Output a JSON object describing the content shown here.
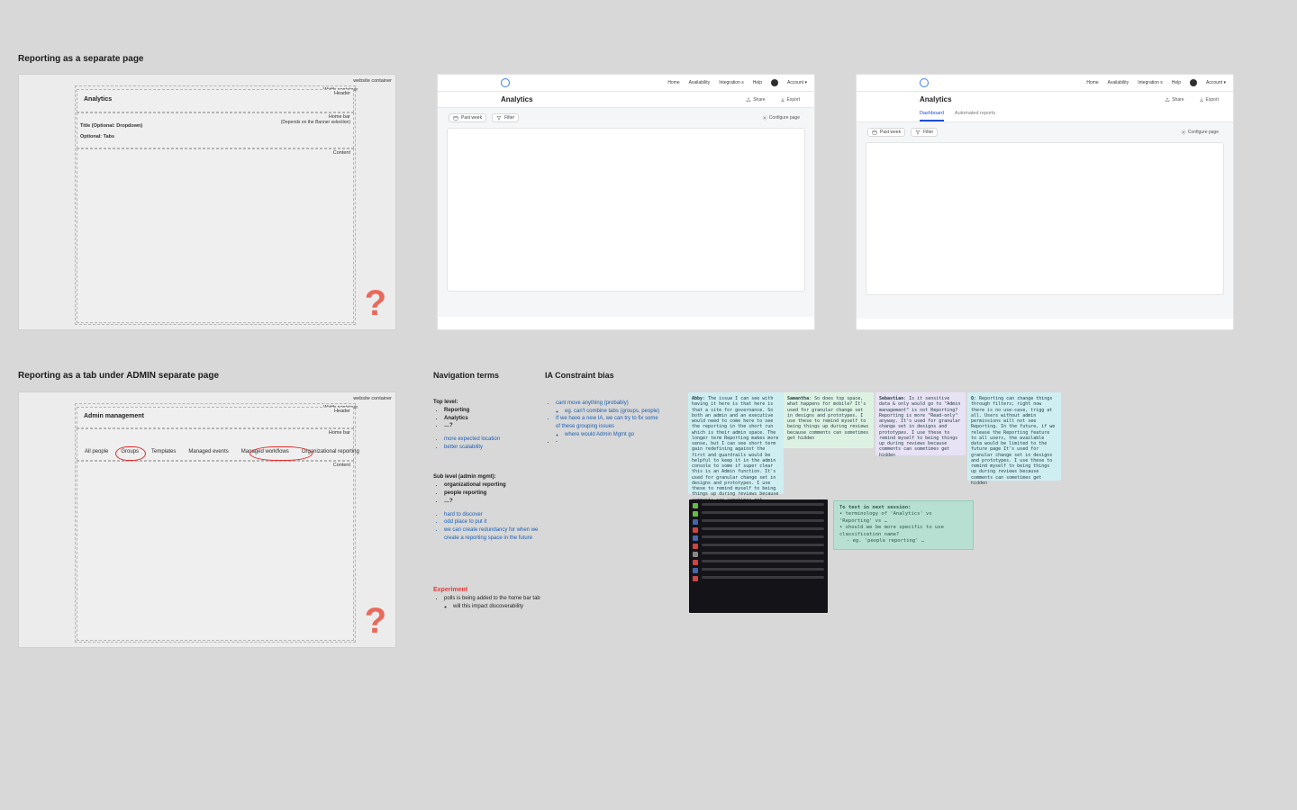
{
  "section1": {
    "title": "Reporting as a separate page"
  },
  "section2": {
    "title": "Reporting as a tab under ADMIN separate page"
  },
  "wire1": {
    "website_container": "website container",
    "width_container": "Width container",
    "header_label": "Header",
    "header_title": "Analytics",
    "home_bar_label": "Home bar",
    "home_bar_sub": "(Depends on the Banner selection)",
    "title_dropdown": "Title (Optional: Dropdown)",
    "optional_tabs": "Optional: Tabs",
    "content_label": "Content",
    "qmark": "?"
  },
  "mockNav": {
    "items": [
      "Home",
      "Availability",
      "Integration s",
      "Help",
      "Account"
    ],
    "caret": "▾"
  },
  "mockA": {
    "title": "Analytics",
    "share": "Share",
    "export": "Export",
    "past_week": "Past week",
    "filter": "Filter",
    "configure": "Configure page"
  },
  "mockB": {
    "title": "Analytics",
    "share": "Share",
    "export": "Export",
    "tabs": [
      "Dashboard",
      "Automated reports"
    ],
    "past_week": "Past week",
    "filter": "Filter",
    "configure": "Configure page"
  },
  "wire2": {
    "website_container": "website container",
    "width_container": "Width container",
    "header_label": "Header",
    "header_title": "Admin management",
    "home_bar_label": "Home bar",
    "tabs": [
      "All people",
      "Groups",
      "Templates",
      "Managed events",
      "Managed workflows",
      "Organizational reporting"
    ],
    "content_label": "Content",
    "qmark": "?"
  },
  "navTerms": {
    "heading": "Navigation  terms",
    "top_level_label": "Top level:",
    "top": [
      "Reporting",
      "Analytics",
      "…?"
    ],
    "top_notes": [
      "more expected location",
      "better scalability"
    ],
    "sub_label": "Sub level (admin mgmt):",
    "sub": [
      "organizational reporting",
      "people reporting",
      "…?"
    ],
    "sub_notes": [
      "hard to discover",
      "odd place to put it",
      "we can create redundancy for when we create a reporting space in the future"
    ],
    "experiment_label": "Experiment",
    "experiment": [
      "polls is being added to the home bar tab",
      "will this impact discoverability"
    ]
  },
  "iaBias": {
    "heading": "IA Constraint bias",
    "items": [
      "cant move anything (probably)",
      "eg. can't combine tabs (groups, people)",
      "If we have a new IA, we can try to fix some of these grouping issues",
      "where would Admin Mgmt go"
    ]
  },
  "stickies": [
    {
      "color": "#cfeef2",
      "name": "Abby",
      "text": "The issue I can see with having it here is that here is that a site for governance. So both an admin and an executive would need to come here to see the reporting in the short run which is their admin space. The longer term Reporting makes more sense, but I can see short term gain redefining against the first and guardrails would be helpful to keep it in the admin console to some if super clear this is an Admin function.\nIt's used for granular change set in designs and prototypes. I use these to remind myself to being things up during reviews because comments can sometimes get hidden"
    },
    {
      "color": "#def2e4",
      "name": "Samantha",
      "text": "So does top space, what happens for mobile?\nIt's used for granular change set in designs and prototypes. I use these to remind myself to being things up during reviews because comments can sometimes get hidden"
    },
    {
      "color": "#e7e2f4",
      "name": "Sebastian",
      "text": "Is it sensitive data & only would go to \"Admin management\" is not Reporting?\nReporting is more \"Read-only\" anyway.\nIt's used for granular change set in designs and prototypes. I use these to remind myself to being things up during reviews because comments can sometimes get hidden"
    },
    {
      "color": "#cfeef2",
      "name": "Q",
      "text": "Reporting can change things through filters; right now there is no use-case, trigg at all.\nUsers without admin permissions will not see Reporting.\nIn the future, if we release the Reporting feature to all users, the available data would be limited to the future page\nIt's used for granular change set in designs and prototypes. I use these to remind myself to being things up during reviews because comments can sometimes get hidden"
    }
  ],
  "toTest": {
    "title": "To test in next session:",
    "lines": [
      "terminology of 'Analytics' vs 'Reporting' vs …",
      "should we be more specific to use classification name?",
      "eg. 'people reporting' …"
    ]
  }
}
